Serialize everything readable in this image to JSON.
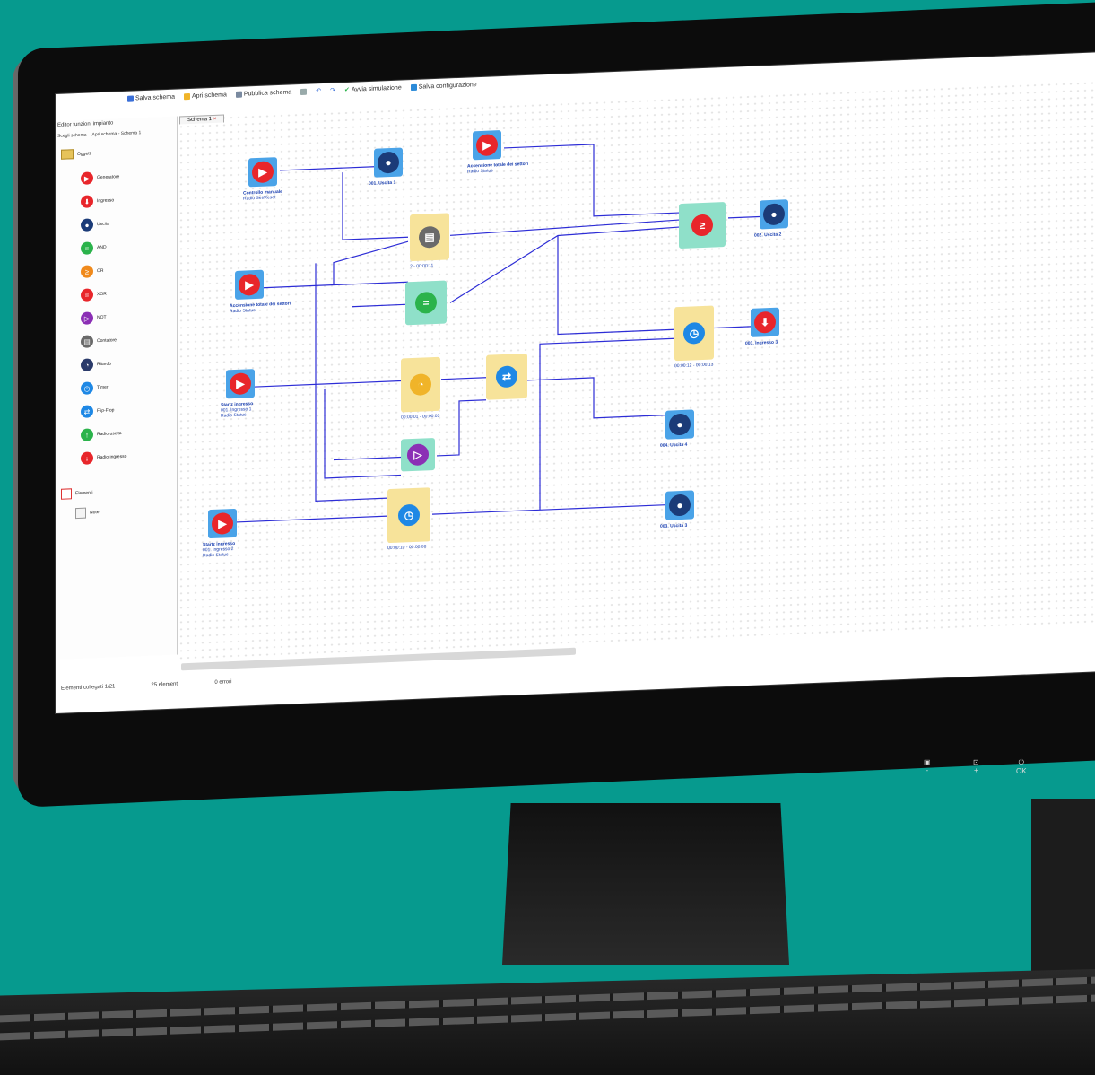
{
  "window": {
    "title": "Editor funzioni impianto"
  },
  "toolbar": {
    "salva_schema": "Salva schema",
    "apri_schema": "Apri schema",
    "pubblica_schema": "Pubblica schema",
    "avvia_simulazione": "Avvia simulazione",
    "salva_configurazione": "Salva configurazione"
  },
  "sidebar": {
    "tabs": [
      "Scegli schema",
      "Apri schema - Schema 1"
    ],
    "root": "Oggetti",
    "items": [
      {
        "label": "Generatore",
        "color": "#e8262b",
        "icon": "play-icon"
      },
      {
        "label": "Ingresso",
        "color": "#e8262b",
        "icon": "down-icon"
      },
      {
        "label": "Uscita",
        "color": "#1b3b78",
        "icon": "bulb-icon"
      },
      {
        "label": "AND",
        "color": "#2bb34b",
        "icon": "and-icon"
      },
      {
        "label": "OR",
        "color": "#f08a1c",
        "icon": "or-icon"
      },
      {
        "label": "XOR",
        "color": "#e8262b",
        "icon": "xor-icon"
      },
      {
        "label": "NOT",
        "color": "#8b2fb5",
        "icon": "not-icon"
      },
      {
        "label": "Contatore",
        "color": "#6a6a6a",
        "icon": "counter-icon"
      },
      {
        "label": "Ritardo",
        "color": "#2a3a6a",
        "icon": "clock-icon"
      },
      {
        "label": "Timer",
        "color": "#1e88e5",
        "icon": "timer-icon"
      },
      {
        "label": "Flip-Flop",
        "color": "#1e88e5",
        "icon": "flipflop-icon"
      },
      {
        "label": "Radio uscita",
        "color": "#2bb34b",
        "icon": "radio-icon"
      },
      {
        "label": "Radio ingresso",
        "color": "#e8262b",
        "icon": "radio-in-icon"
      }
    ],
    "section2": "Elementi",
    "section2_item": "Note"
  },
  "canvas": {
    "tab": "Schema 1",
    "labels": {
      "n1": [
        "Controllo manuale",
        "Radio Set/Reset"
      ],
      "n2": [
        "001. Uscita 1"
      ],
      "n3": [
        "Accensione totale dei settori",
        "Radio Status"
      ],
      "n4": [
        "Accensione totale dei settori",
        "Radio Status"
      ],
      "n5": [
        "Startz ingresso",
        "001. Ingresso 1",
        "Radio Status"
      ],
      "n6": [
        "Startz ingresso",
        "001. Ingresso 2",
        "Radio Status"
      ],
      "n7": [
        "002. Uscita 2"
      ],
      "n8": [
        "003. Ingresso 3"
      ],
      "n9": [
        "004. Uscita 4"
      ],
      "n10": [
        "003. Uscita 3"
      ],
      "g1": "2 - 00:00:11",
      "g2": "00:00:01 - 00:00:03",
      "g3": "00:00:12 - 00:00:13",
      "g4": "00:00:10 - 00:00:00"
    }
  },
  "statusbar": {
    "left": "Elementi collegati 1/21",
    "mid": "25 elementi",
    "right": "0 errori"
  },
  "monitor_buttons": [
    "-",
    "+",
    "OK"
  ]
}
